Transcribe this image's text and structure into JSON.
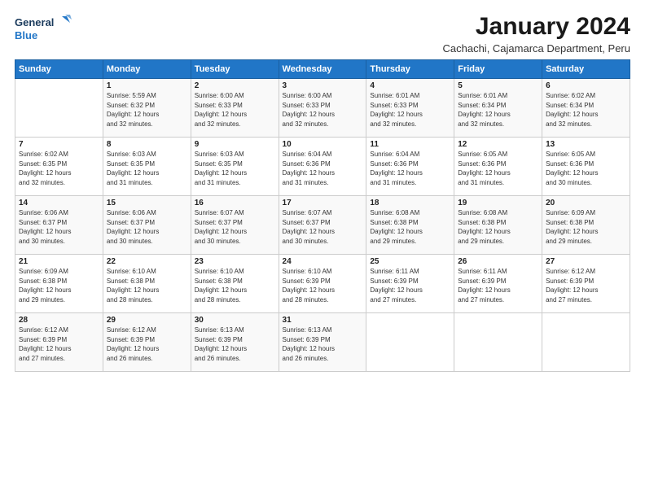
{
  "logo": {
    "line1": "General",
    "line2": "Blue"
  },
  "title": "January 2024",
  "subtitle": "Cachachi, Cajamarca Department, Peru",
  "header": {
    "days": [
      "Sunday",
      "Monday",
      "Tuesday",
      "Wednesday",
      "Thursday",
      "Friday",
      "Saturday"
    ]
  },
  "weeks": [
    [
      {
        "num": "",
        "info": ""
      },
      {
        "num": "1",
        "info": "Sunrise: 5:59 AM\nSunset: 6:32 PM\nDaylight: 12 hours\nand 32 minutes."
      },
      {
        "num": "2",
        "info": "Sunrise: 6:00 AM\nSunset: 6:33 PM\nDaylight: 12 hours\nand 32 minutes."
      },
      {
        "num": "3",
        "info": "Sunrise: 6:00 AM\nSunset: 6:33 PM\nDaylight: 12 hours\nand 32 minutes."
      },
      {
        "num": "4",
        "info": "Sunrise: 6:01 AM\nSunset: 6:33 PM\nDaylight: 12 hours\nand 32 minutes."
      },
      {
        "num": "5",
        "info": "Sunrise: 6:01 AM\nSunset: 6:34 PM\nDaylight: 12 hours\nand 32 minutes."
      },
      {
        "num": "6",
        "info": "Sunrise: 6:02 AM\nSunset: 6:34 PM\nDaylight: 12 hours\nand 32 minutes."
      }
    ],
    [
      {
        "num": "7",
        "info": "Sunrise: 6:02 AM\nSunset: 6:35 PM\nDaylight: 12 hours\nand 32 minutes."
      },
      {
        "num": "8",
        "info": "Sunrise: 6:03 AM\nSunset: 6:35 PM\nDaylight: 12 hours\nand 31 minutes."
      },
      {
        "num": "9",
        "info": "Sunrise: 6:03 AM\nSunset: 6:35 PM\nDaylight: 12 hours\nand 31 minutes."
      },
      {
        "num": "10",
        "info": "Sunrise: 6:04 AM\nSunset: 6:36 PM\nDaylight: 12 hours\nand 31 minutes."
      },
      {
        "num": "11",
        "info": "Sunrise: 6:04 AM\nSunset: 6:36 PM\nDaylight: 12 hours\nand 31 minutes."
      },
      {
        "num": "12",
        "info": "Sunrise: 6:05 AM\nSunset: 6:36 PM\nDaylight: 12 hours\nand 31 minutes."
      },
      {
        "num": "13",
        "info": "Sunrise: 6:05 AM\nSunset: 6:36 PM\nDaylight: 12 hours\nand 30 minutes."
      }
    ],
    [
      {
        "num": "14",
        "info": "Sunrise: 6:06 AM\nSunset: 6:37 PM\nDaylight: 12 hours\nand 30 minutes."
      },
      {
        "num": "15",
        "info": "Sunrise: 6:06 AM\nSunset: 6:37 PM\nDaylight: 12 hours\nand 30 minutes."
      },
      {
        "num": "16",
        "info": "Sunrise: 6:07 AM\nSunset: 6:37 PM\nDaylight: 12 hours\nand 30 minutes."
      },
      {
        "num": "17",
        "info": "Sunrise: 6:07 AM\nSunset: 6:37 PM\nDaylight: 12 hours\nand 30 minutes."
      },
      {
        "num": "18",
        "info": "Sunrise: 6:08 AM\nSunset: 6:38 PM\nDaylight: 12 hours\nand 29 minutes."
      },
      {
        "num": "19",
        "info": "Sunrise: 6:08 AM\nSunset: 6:38 PM\nDaylight: 12 hours\nand 29 minutes."
      },
      {
        "num": "20",
        "info": "Sunrise: 6:09 AM\nSunset: 6:38 PM\nDaylight: 12 hours\nand 29 minutes."
      }
    ],
    [
      {
        "num": "21",
        "info": "Sunrise: 6:09 AM\nSunset: 6:38 PM\nDaylight: 12 hours\nand 29 minutes."
      },
      {
        "num": "22",
        "info": "Sunrise: 6:10 AM\nSunset: 6:38 PM\nDaylight: 12 hours\nand 28 minutes."
      },
      {
        "num": "23",
        "info": "Sunrise: 6:10 AM\nSunset: 6:38 PM\nDaylight: 12 hours\nand 28 minutes."
      },
      {
        "num": "24",
        "info": "Sunrise: 6:10 AM\nSunset: 6:39 PM\nDaylight: 12 hours\nand 28 minutes."
      },
      {
        "num": "25",
        "info": "Sunrise: 6:11 AM\nSunset: 6:39 PM\nDaylight: 12 hours\nand 27 minutes."
      },
      {
        "num": "26",
        "info": "Sunrise: 6:11 AM\nSunset: 6:39 PM\nDaylight: 12 hours\nand 27 minutes."
      },
      {
        "num": "27",
        "info": "Sunrise: 6:12 AM\nSunset: 6:39 PM\nDaylight: 12 hours\nand 27 minutes."
      }
    ],
    [
      {
        "num": "28",
        "info": "Sunrise: 6:12 AM\nSunset: 6:39 PM\nDaylight: 12 hours\nand 27 minutes."
      },
      {
        "num": "29",
        "info": "Sunrise: 6:12 AM\nSunset: 6:39 PM\nDaylight: 12 hours\nand 26 minutes."
      },
      {
        "num": "30",
        "info": "Sunrise: 6:13 AM\nSunset: 6:39 PM\nDaylight: 12 hours\nand 26 minutes."
      },
      {
        "num": "31",
        "info": "Sunrise: 6:13 AM\nSunset: 6:39 PM\nDaylight: 12 hours\nand 26 minutes."
      },
      {
        "num": "",
        "info": ""
      },
      {
        "num": "",
        "info": ""
      },
      {
        "num": "",
        "info": ""
      }
    ]
  ]
}
